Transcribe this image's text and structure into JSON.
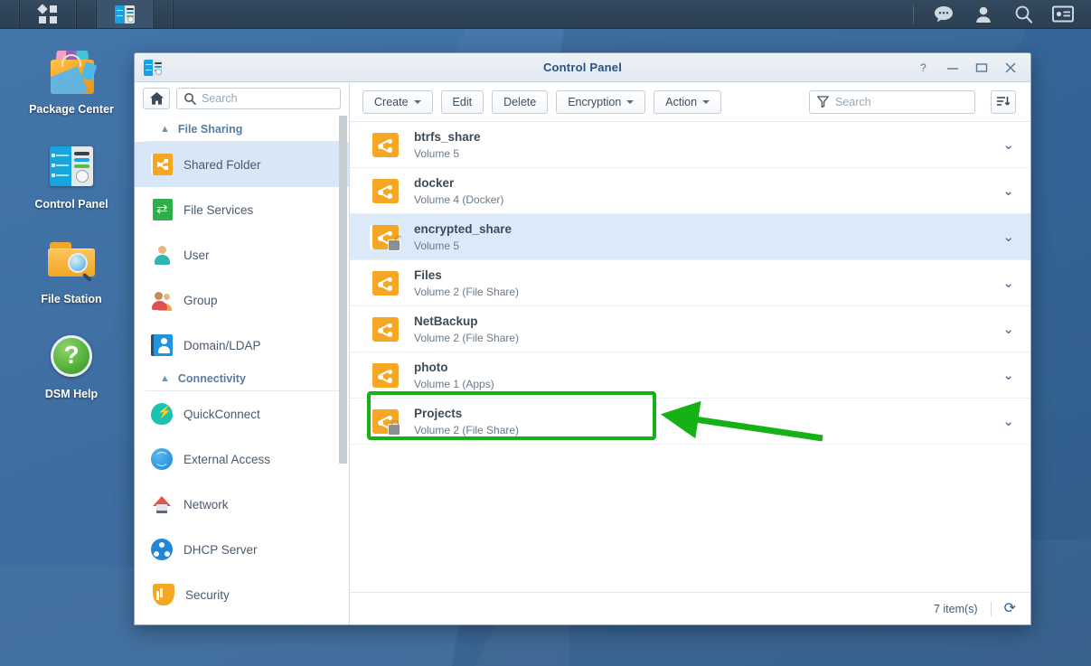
{
  "taskbar": {
    "main_menu_label": "main-menu",
    "apps": [
      {
        "name": "Control Panel",
        "icon": "control-panel-icon",
        "active": true
      }
    ],
    "tray": [
      {
        "name": "Notifications",
        "icon": "chat-bubble-icon"
      },
      {
        "name": "Personal",
        "icon": "person-icon"
      },
      {
        "name": "Search",
        "icon": "search-icon"
      },
      {
        "name": "Widgets",
        "icon": "contact-card-icon"
      }
    ]
  },
  "desktop": {
    "icons": [
      {
        "label": "Package Center",
        "icon": "package-center-icon"
      },
      {
        "label": "Control Panel",
        "icon": "control-panel-icon"
      },
      {
        "label": "File Station",
        "icon": "file-station-icon"
      },
      {
        "label": "DSM Help",
        "icon": "dsm-help-icon"
      }
    ]
  },
  "window": {
    "title": "Control Panel",
    "controls": {
      "help": "?",
      "minimize": "minimize-icon",
      "maximize": "maximize-icon",
      "close": "close-icon"
    }
  },
  "sidebar": {
    "home_button": "home-icon",
    "search": {
      "placeholder": "Search",
      "value": ""
    },
    "sections": [
      {
        "title": "File Sharing",
        "items": [
          {
            "label": "Shared Folder",
            "icon": "shared-folder-icon",
            "selected": true
          },
          {
            "label": "File Services",
            "icon": "file-services-icon",
            "selected": false
          },
          {
            "label": "User",
            "icon": "user-icon",
            "selected": false
          },
          {
            "label": "Group",
            "icon": "group-icon",
            "selected": false
          },
          {
            "label": "Domain/LDAP",
            "icon": "domain-ldap-icon",
            "selected": false
          }
        ]
      },
      {
        "title": "Connectivity",
        "items": [
          {
            "label": "QuickConnect",
            "icon": "quickconnect-icon",
            "selected": false
          },
          {
            "label": "External Access",
            "icon": "external-access-icon",
            "selected": false
          },
          {
            "label": "Network",
            "icon": "network-icon",
            "selected": false
          },
          {
            "label": "DHCP Server",
            "icon": "dhcp-server-icon",
            "selected": false
          },
          {
            "label": "Security",
            "icon": "security-icon",
            "selected": false
          }
        ]
      }
    ]
  },
  "toolbar": {
    "buttons": [
      {
        "label": "Create",
        "has_caret": true
      },
      {
        "label": "Edit",
        "has_caret": false
      },
      {
        "label": "Delete",
        "has_caret": false
      },
      {
        "label": "Encryption",
        "has_caret": true
      },
      {
        "label": "Action",
        "has_caret": true
      }
    ],
    "filter": {
      "placeholder": "Search",
      "value": "",
      "icon": "filter-icon"
    },
    "sort_button": "sort-descending-icon"
  },
  "list": {
    "rows": [
      {
        "name": "btrfs_share",
        "volume": "Volume 5",
        "encrypted": false,
        "locked": false,
        "selected": false
      },
      {
        "name": "docker",
        "volume": "Volume 4 (Docker)",
        "encrypted": false,
        "locked": false,
        "selected": false
      },
      {
        "name": "encrypted_share",
        "volume": "Volume 5",
        "encrypted": true,
        "locked": false,
        "selected": true
      },
      {
        "name": "Files",
        "volume": "Volume 2 (File Share)",
        "encrypted": false,
        "locked": false,
        "selected": false
      },
      {
        "name": "NetBackup",
        "volume": "Volume 2 (File Share)",
        "encrypted": false,
        "locked": false,
        "selected": false
      },
      {
        "name": "photo",
        "volume": "Volume 1 (Apps)",
        "encrypted": false,
        "locked": false,
        "selected": false
      },
      {
        "name": "Projects",
        "volume": "Volume 2 (File Share)",
        "encrypted": true,
        "locked": true,
        "selected": false
      }
    ],
    "expand_icon": "chevron-down-icon"
  },
  "statusbar": {
    "item_count": "7 item(s)",
    "refresh": "refresh-icon"
  },
  "annotation": {
    "color": "#16b117",
    "highlight_target": "Projects",
    "shapes": [
      "rectangle",
      "arrow"
    ]
  }
}
